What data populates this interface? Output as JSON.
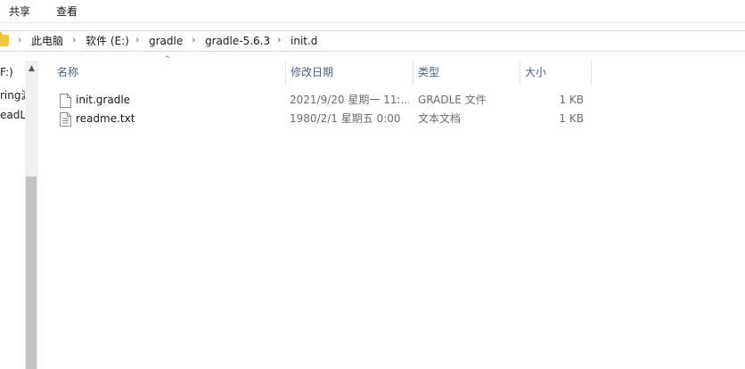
{
  "ribbon": {
    "tabs": [
      {
        "label": "共享"
      },
      {
        "label": "查看"
      }
    ]
  },
  "address": {
    "crumbs": [
      {
        "label": "此电脑"
      },
      {
        "label": "软件 (E:)"
      },
      {
        "label": "gradle"
      },
      {
        "label": "gradle-5.6.3"
      },
      {
        "label": "init.d"
      }
    ]
  },
  "nav": {
    "items": [
      {
        "label": "F:)"
      },
      {
        "label": "ring源"
      },
      {
        "label": "eadL"
      }
    ]
  },
  "columns": {
    "name": "名称",
    "modified": "修改日期",
    "type": "类型",
    "size": "大小"
  },
  "files": [
    {
      "name": "init.gradle",
      "modified": "2021/9/20 星期一 11:...",
      "type": "GRADLE 文件",
      "size": "1 KB",
      "icon": "file-icon"
    },
    {
      "name": "readme.txt",
      "modified": "1980/2/1 星期五 0:00",
      "type": "文本文档",
      "size": "1 KB",
      "icon": "text-file-icon"
    }
  ]
}
